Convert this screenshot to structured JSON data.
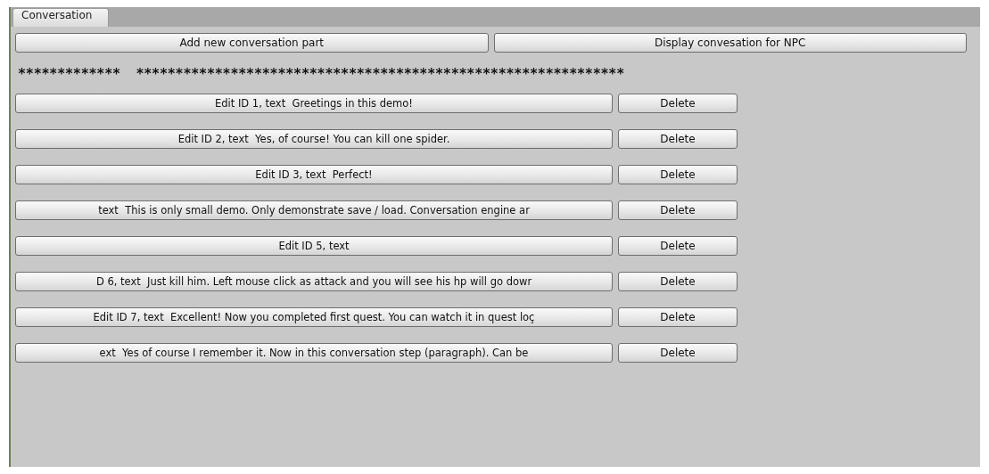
{
  "tabs": [
    {
      "label": "Conversation",
      "selected": true
    }
  ],
  "toolbar": {
    "buttons": [
      "Add new conversation part",
      "Display convesation for NPC"
    ]
  },
  "header": {
    "text": "*************  **************************************************************"
  },
  "rows": [
    {
      "edit": "Edit ID 1, text  Greetings in this demo!",
      "delete": "Delete"
    },
    {
      "edit": "Edit ID 2, text  Yes, of course! You can kill one spider.",
      "delete": "Delete"
    },
    {
      "edit": "Edit ID 3, text  Perfect!",
      "delete": "Delete"
    },
    {
      "edit": "text  This is only small demo. Only demonstrate save / load. Conversation engine ar",
      "delete": "Delete"
    },
    {
      "edit": "Edit ID 5, text",
      "delete": "Delete"
    },
    {
      "edit": "D 6, text  Just kill him. Left mouse click as attack and you will see his hp will go dowr",
      "delete": "Delete"
    },
    {
      "edit": "Edit ID 7, text  Excellent! Now you completed first quest. You can watch it in quest loç",
      "delete": "Delete"
    },
    {
      "edit": "ext  Yes of course I remember it. Now in this conversation step (paragraph). Can be",
      "delete": "Delete"
    }
  ]
}
